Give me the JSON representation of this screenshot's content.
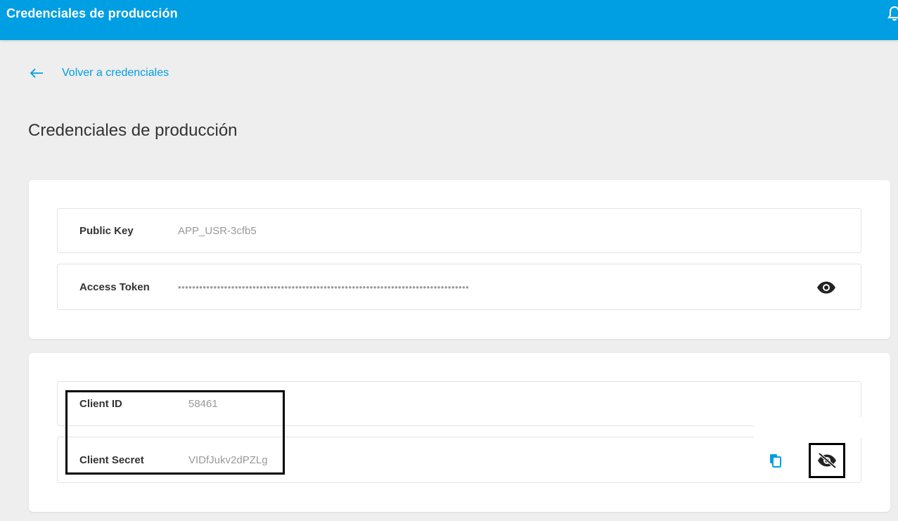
{
  "header": {
    "title": "Credenciales de producción",
    "accent_color": "#009ee3",
    "icon": "bell-icon"
  },
  "back_link": {
    "icon": "arrow-left-icon",
    "label": "Volver a credenciales"
  },
  "page": {
    "title": "Credenciales de producción"
  },
  "production_card": {
    "public_key": {
      "label": "Public Key",
      "value": "APP_USR-3cfb5"
    },
    "access_token": {
      "label": "Access Token",
      "value": "••••••••••••••••••••••••••••••••••••••••••••••••••••••••••••••••••••••••••••••••••",
      "toggle_icon": "eye-icon"
    }
  },
  "client_card": {
    "client_id": {
      "label": "Client ID",
      "value": "58461"
    },
    "client_secret": {
      "label": "Client Secret",
      "value": "VIDfJukv2dPZLg",
      "copy_icon": "copy-icon",
      "toggle_icon": "eye-off-icon"
    }
  }
}
